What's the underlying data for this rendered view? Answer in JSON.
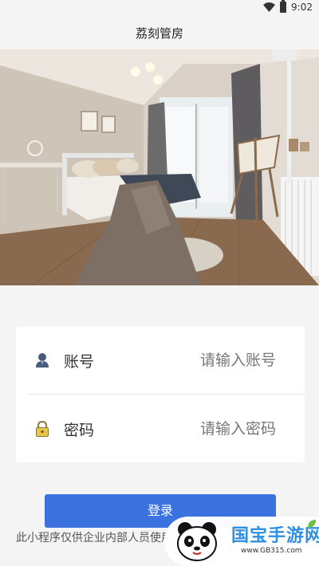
{
  "status_bar": {
    "time": "9:02",
    "wifi_icon": "wifi-icon",
    "battery_icon": "battery-icon"
  },
  "header": {
    "title": "荔刻管房"
  },
  "hero": {
    "image": "bedroom-photo"
  },
  "form": {
    "account": {
      "label": "账号",
      "placeholder": "请输入账号",
      "icon": "user-icon"
    },
    "password": {
      "label": "密码",
      "placeholder": "请输入密码",
      "icon": "lock-icon"
    }
  },
  "login_button": {
    "label": "登录"
  },
  "notice": "此小程序仅供企业内部人员使用",
  "watermark": {
    "brand": "国宝手游网",
    "url": "www.GB315.com",
    "icon": "panda-logo"
  },
  "colors": {
    "primary": "#3b72e0",
    "background": "#f4f4f4",
    "card": "#ffffff"
  }
}
